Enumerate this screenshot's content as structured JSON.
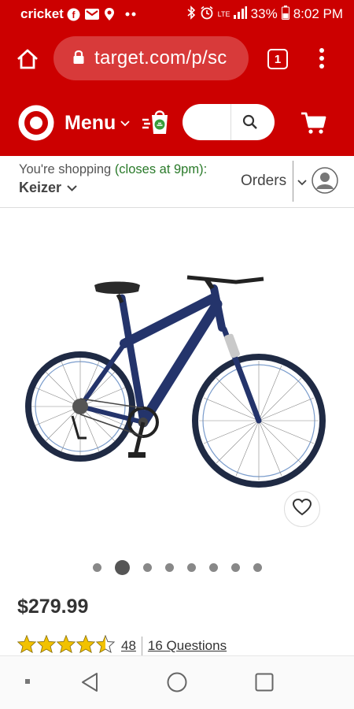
{
  "status_bar": {
    "carrier": "cricket",
    "network": "LTE",
    "battery": "33%",
    "time": "8:02 PM"
  },
  "browser": {
    "url": "target.com/p/sc",
    "tab_count": "1"
  },
  "target_nav": {
    "menu_label": "Menu",
    "search_placeholder": ""
  },
  "store": {
    "prefix": "You're shopping ",
    "hours": "(closes at 9pm):",
    "name": "Keizer",
    "orders_label": "Orders"
  },
  "product": {
    "price": "$279.99",
    "rating": 4.5,
    "review_count": "48",
    "questions_label": "16 Questions",
    "image_count": 8,
    "active_image": 1
  },
  "colors": {
    "brand_red": "#cc0000",
    "store_hours_green": "#2a7a2a",
    "star_gold": "#f2c200"
  }
}
